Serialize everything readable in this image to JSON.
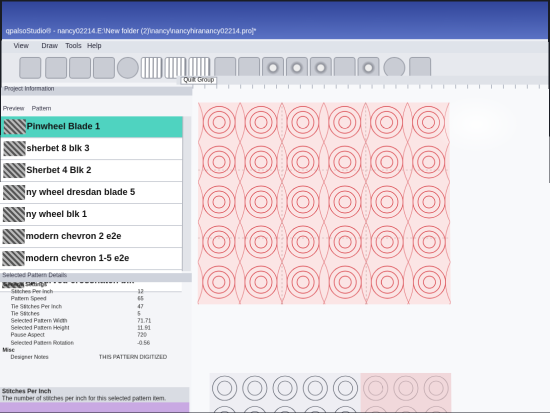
{
  "window": {
    "title": "qpalsoStudio® - nancy02214.E:\\New folder (2)\\nancy\\nancyhiranancy02214.pro]*"
  },
  "menu": [
    "View",
    "Draw",
    "Tools",
    "Help"
  ],
  "toolbar": {
    "icons": [
      "stop-icon",
      "bucket-icon",
      "align-icon",
      "shapes-icon",
      "record-icon",
      "grid-icon",
      "grid-icon",
      "grid-icon",
      "sewing-icon",
      "scissors-icon",
      "gear-icon",
      "gear-icon",
      "gear-icon",
      "arrow-icon",
      "gear-icon",
      "zoom-icon",
      "layout-icon"
    ]
  },
  "left_panel": {
    "header": "Project Information",
    "tabs": [
      "Preview",
      "Pattern"
    ],
    "patterns": [
      {
        "label": "Pinwheel Blade  1",
        "selected": true
      },
      {
        "label": "sherbet 8 blk 3",
        "selected": false
      },
      {
        "label": "Sherbet 4 Blk 2",
        "selected": false
      },
      {
        "label": "ny wheel dresdan blade 5",
        "selected": false
      },
      {
        "label": "ny wheel blk 1",
        "selected": false
      },
      {
        "label": "modern chevron 2 e2e",
        "selected": false
      },
      {
        "label": "modern chevron 1-5 e2e",
        "selected": false
      },
      {
        "label": "kp curved crosshatch blk",
        "selected": false
      }
    ],
    "details_header": "Selected Pattern Details",
    "details": [
      {
        "key": "General Settings",
        "value": "",
        "section": true
      },
      {
        "key": "Stitches Per Inch",
        "value": "12"
      },
      {
        "key": "Pattern Speed",
        "value": "65"
      },
      {
        "key": "Tie Stitches Per Inch",
        "value": "47"
      },
      {
        "key": "Tie Stitches",
        "value": "5"
      },
      {
        "key": "Selected Pattern Width",
        "value": "71.71"
      },
      {
        "key": "Selected Pattern Height",
        "value": "11.91"
      },
      {
        "key": "Pause Aspect",
        "value": "720"
      },
      {
        "key": "Selected Pattern Rotation",
        "value": "-0.56"
      },
      {
        "key": "Misc",
        "value": "",
        "section": true
      },
      {
        "key": "Designer Notes",
        "value": "THIS PATTERN DIGITIZED"
      }
    ],
    "status_lines": [
      "Stitches Per Inch",
      "The number of stitches per inch for this selected pattern item."
    ]
  },
  "canvas": {
    "tab": "Quilt Group"
  },
  "colors": {
    "accent_selected": "#4fd3c0",
    "pattern": "#d9434a",
    "title_bar": "#31459a"
  }
}
